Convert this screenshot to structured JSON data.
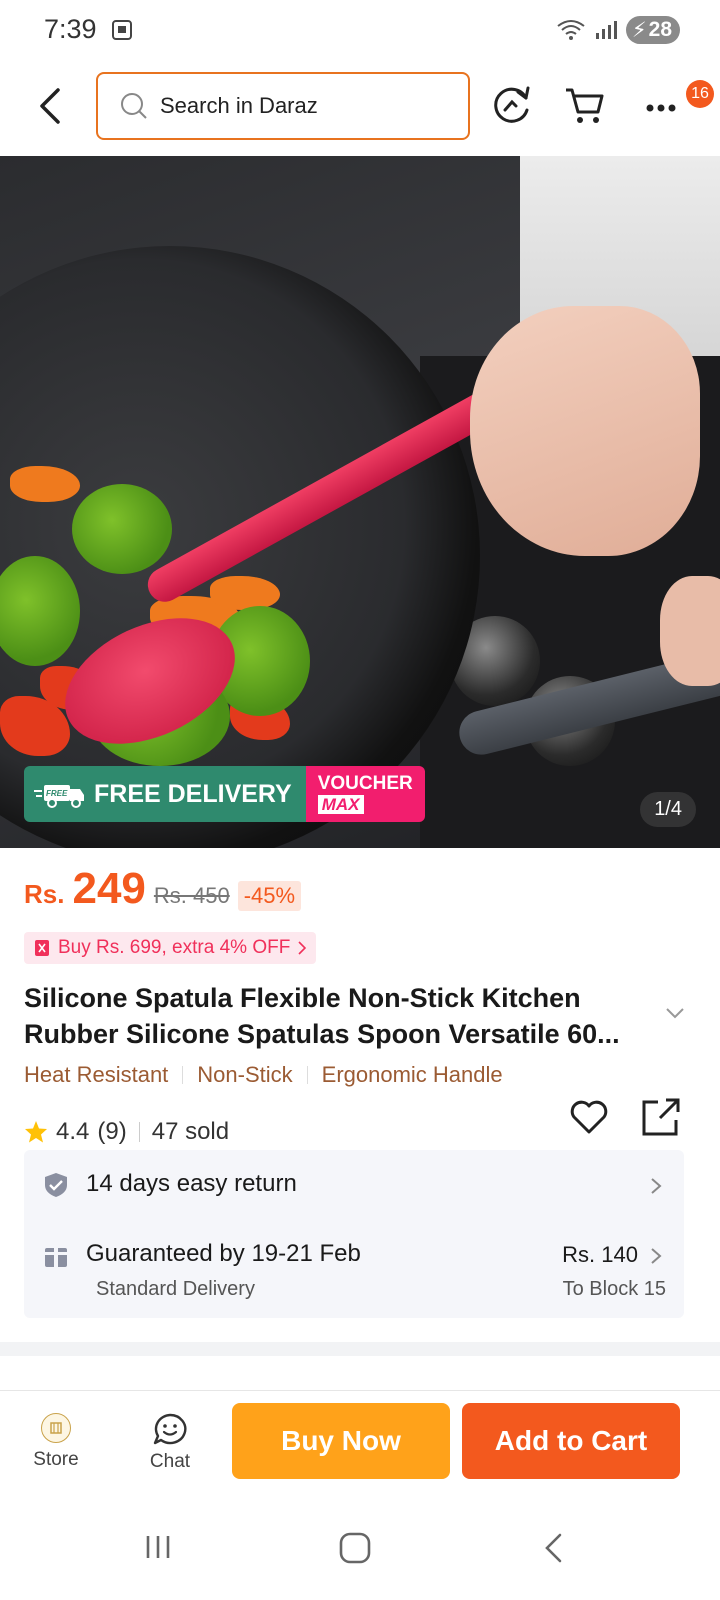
{
  "status_bar": {
    "time": "7:39",
    "battery": "28"
  },
  "header": {
    "search_placeholder": "Search in Daraz",
    "cart_badge": "16"
  },
  "hero": {
    "free_delivery": "FREE DELIVERY",
    "free_small": "FREE",
    "voucher_line1": "VOUCHER",
    "voucher_line2": "MAX",
    "image_counter": "1/4"
  },
  "product": {
    "currency": "Rs.",
    "price": "249",
    "original_price": "Rs. 450",
    "discount": "-45%",
    "voucher_offer": "Buy Rs. 699, extra 4% OFF",
    "title": "Silicone Spatula Flexible Non-Stick Kitchen Rubber Silicone Spatulas Spoon Versatile 60...",
    "features": [
      "Heat Resistant",
      "Non-Stick",
      "Ergonomic Handle"
    ],
    "rating": "4.4",
    "rating_count": "(9)",
    "sold": "47 sold"
  },
  "service": {
    "returns": "14 days easy return",
    "delivery_guarantee": "Guaranteed by 19-21 Feb",
    "delivery_type": "Standard Delivery",
    "delivery_fee": "Rs. 140",
    "delivery_location": "To Block 15"
  },
  "bottom_bar": {
    "store_label": "Store",
    "chat_label": "Chat",
    "buy_now": "Buy Now",
    "add_to_cart": "Add to Cart"
  },
  "colors": {
    "accent": "#f3591e",
    "buy_now": "#ffa21a",
    "search_border": "#e8731f",
    "free_delivery_bg": "#2f8a6e",
    "voucher_bg": "#f21e6e",
    "feature_text": "#9b5b33"
  },
  "icons": [
    "back-icon",
    "search-icon",
    "refresh-icon",
    "cart-icon",
    "more-icon",
    "star-icon",
    "heart-icon",
    "share-icon",
    "shield-icon",
    "gift-icon",
    "chevron-right-icon",
    "chat-icon"
  ]
}
